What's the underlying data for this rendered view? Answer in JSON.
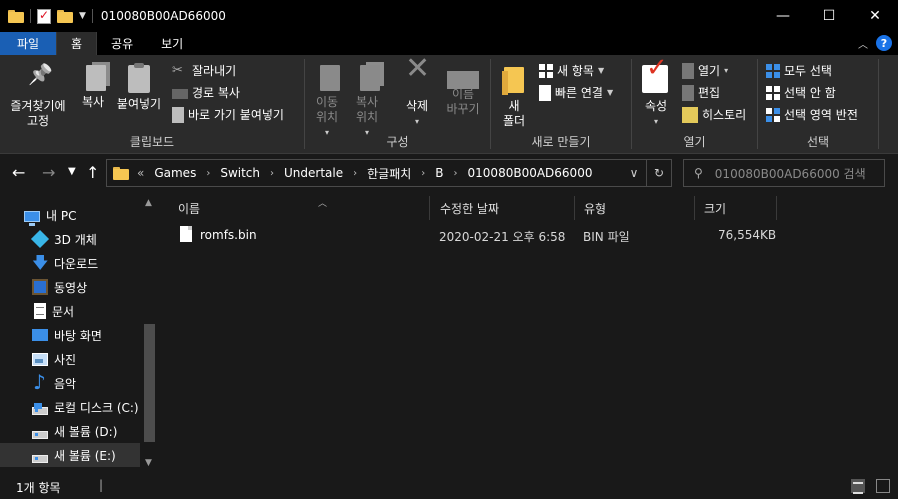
{
  "window": {
    "title": "010080B00AD66000",
    "minimize": "—",
    "maximize": "☐",
    "close": "✕"
  },
  "tabs": {
    "file": "파일",
    "home": "홈",
    "share": "공유",
    "view": "보기"
  },
  "ribbon": {
    "clipboard": {
      "label": "클립보드",
      "pin": "즐겨찾기에\n고정",
      "copy": "복사",
      "paste": "붙여넣기",
      "cut": "잘라내기",
      "copy_path": "경로 복사",
      "paste_shortcut": "바로 가기 붙여넣기"
    },
    "organize": {
      "label": "구성",
      "move_to": "이동\n위치",
      "copy_to": "복사\n위치",
      "delete": "삭제",
      "rename": "이름\n바꾸기"
    },
    "new": {
      "label": "새로 만들기",
      "new_folder": "새\n폴더",
      "new_item": "새 항목",
      "easy_access": "빠른 연결"
    },
    "open": {
      "label": "열기",
      "properties": "속성",
      "open": "열기",
      "edit": "편집",
      "history": "히스토리"
    },
    "select": {
      "label": "선택",
      "select_all": "모두 선택",
      "select_none": "선택 안 함",
      "invert": "선택 영역 반전"
    }
  },
  "address": {
    "overflow": "«",
    "crumbs": [
      "Games",
      "Switch",
      "Undertale",
      "한글패치",
      "B",
      "010080B00AD66000"
    ],
    "search_placeholder": "010080B00AD66000 검색"
  },
  "nav": {
    "items": [
      {
        "label": "내 PC",
        "icon": "pc-icon"
      },
      {
        "label": "3D 개체",
        "icon": "3d-objects-icon"
      },
      {
        "label": "다운로드",
        "icon": "download-icon"
      },
      {
        "label": "동영상",
        "icon": "video-icon"
      },
      {
        "label": "문서",
        "icon": "document-icon"
      },
      {
        "label": "바탕 화면",
        "icon": "desktop-icon"
      },
      {
        "label": "사진",
        "icon": "pictures-icon"
      },
      {
        "label": "음악",
        "icon": "music-icon"
      },
      {
        "label": "로컬 디스크 (C:)",
        "icon": "system-drive-icon"
      },
      {
        "label": "새 볼륨 (D:)",
        "icon": "drive-icon"
      },
      {
        "label": "새 볼륨 (E:)",
        "icon": "drive-icon"
      }
    ]
  },
  "columns": {
    "name": "이름",
    "modified": "수정한 날짜",
    "type": "유형",
    "size": "크기"
  },
  "files": [
    {
      "name": "romfs.bin",
      "modified": "2020-02-21 오후 6:58",
      "type": "BIN 파일",
      "size": "76,554KB"
    }
  ],
  "status": {
    "count": "1개 항목"
  },
  "colors": {
    "accent": "#1a5fb4",
    "background": "#191919",
    "ribbon": "#2b2b2b"
  }
}
